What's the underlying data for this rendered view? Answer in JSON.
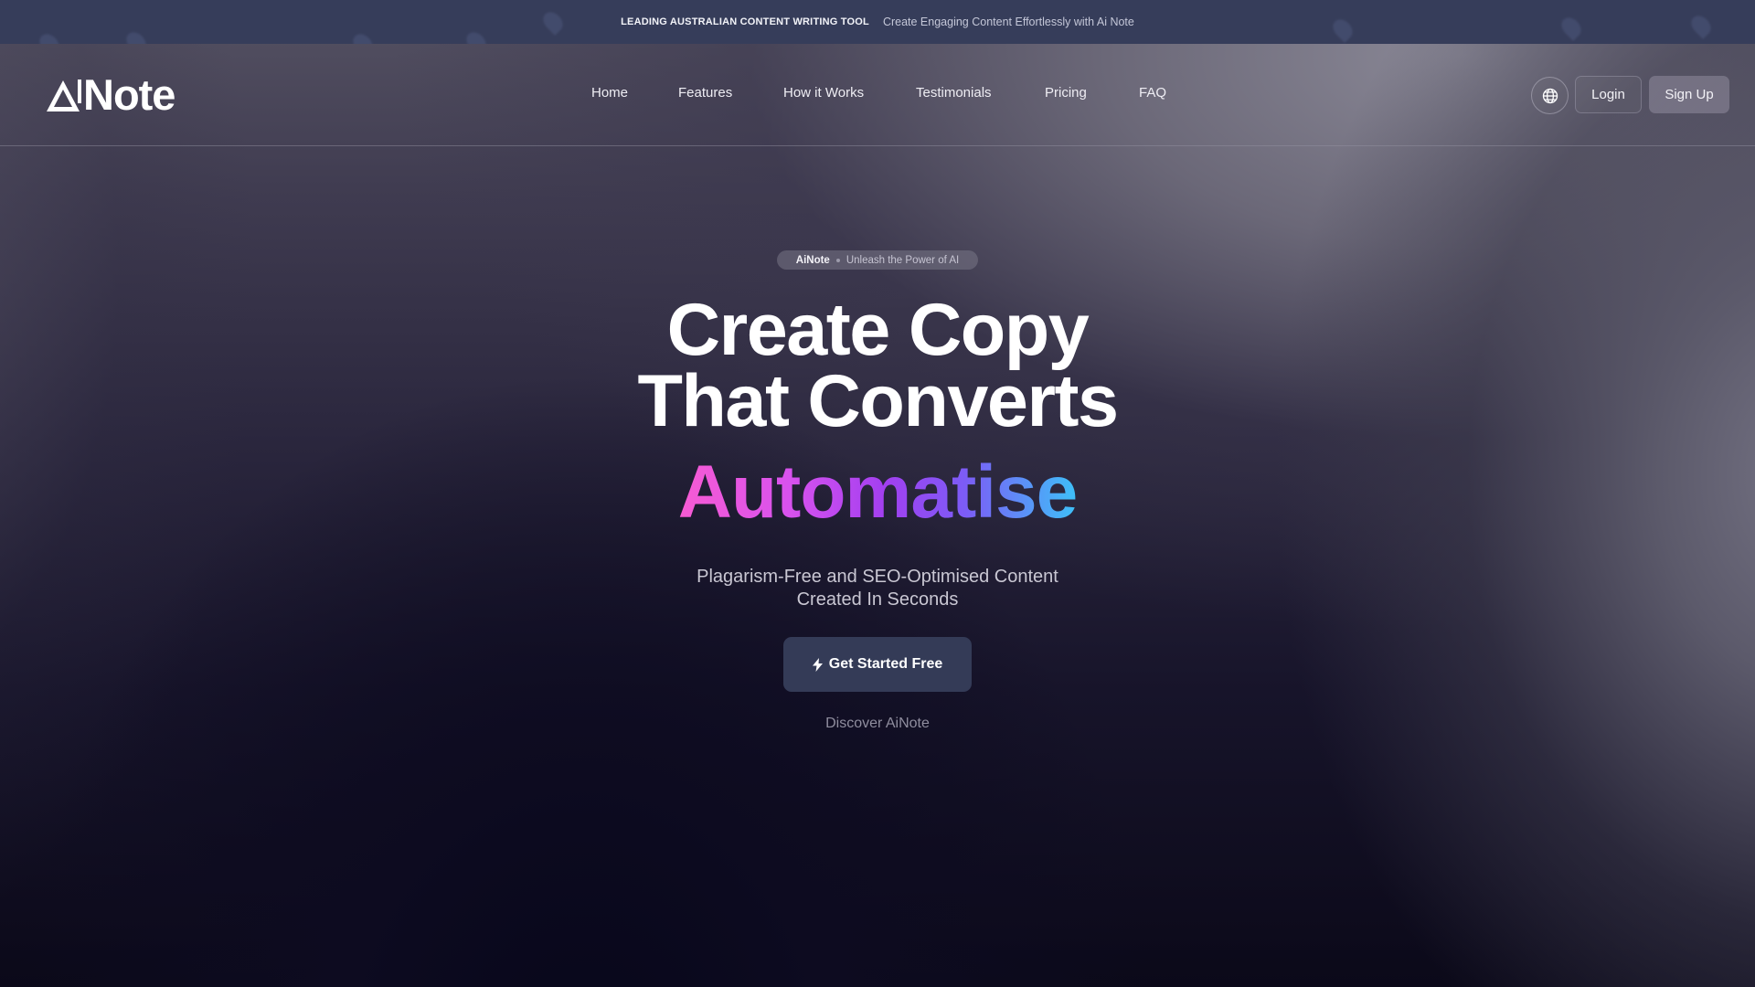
{
  "banner": {
    "headline": "LEADING AUSTRALIAN CONTENT WRITING TOOL",
    "tagline": "Create Engaging Content Effortlessly with Ai Note",
    "background_color": "#363d5a"
  },
  "header": {
    "logo_text": "Note",
    "logo_full_name": "AiNote",
    "nav": [
      {
        "label": "Home"
      },
      {
        "label": "Features"
      },
      {
        "label": "How it Works"
      },
      {
        "label": "Testimonials"
      },
      {
        "label": "Pricing"
      },
      {
        "label": "FAQ"
      }
    ],
    "language_icon": "globe-icon",
    "login_label": "Login",
    "signup_label": "Sign Up"
  },
  "hero": {
    "pill_brand": "AiNote",
    "pill_tagline": "Unleash the Power of AI",
    "headline_line1": "Create Copy",
    "headline_line2": "That Converts",
    "gradient_word": "Automatise",
    "gradient_colors": [
      "#f75bd3",
      "#d852ee",
      "#a23ff0",
      "#7c5cf6",
      "#3ec0f8"
    ],
    "subtitle_line1": "Plagarism-Free and SEO-Optimised Content",
    "subtitle_line2": "Created In Seconds",
    "cta_label": "Get Started Free",
    "cta_icon": "lightning-bolt-icon",
    "discover_label": "Discover AiNote"
  }
}
